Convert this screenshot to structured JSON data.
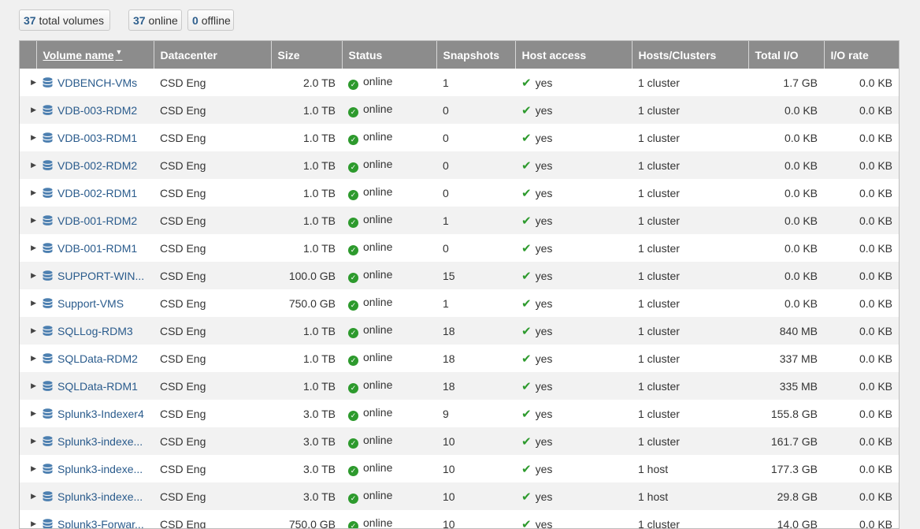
{
  "filters": {
    "total": {
      "count": "37",
      "label": "total volumes"
    },
    "online": {
      "count": "37",
      "label": "online"
    },
    "offline": {
      "count": "0",
      "label": "offline"
    }
  },
  "table": {
    "columns": {
      "name": "Volume name",
      "datacenter": "Datacenter",
      "size": "Size",
      "status": "Status",
      "snapshots": "Snapshots",
      "host_access": "Host access",
      "hosts_clusters": "Hosts/Clusters",
      "total_io": "Total I/O",
      "io_rate": "I/O rate"
    },
    "rows": [
      {
        "name": "VDBENCH-VMs",
        "datacenter": "CSD Eng",
        "size": "2.0 TB",
        "status": "online",
        "snapshots": "1",
        "host_access": "yes",
        "hosts_clusters": "1 cluster",
        "total_io": "1.7 GB",
        "io_rate": "0.0 KB"
      },
      {
        "name": "VDB-003-RDM2",
        "datacenter": "CSD Eng",
        "size": "1.0 TB",
        "status": "online",
        "snapshots": "0",
        "host_access": "yes",
        "hosts_clusters": "1 cluster",
        "total_io": "0.0 KB",
        "io_rate": "0.0 KB"
      },
      {
        "name": "VDB-003-RDM1",
        "datacenter": "CSD Eng",
        "size": "1.0 TB",
        "status": "online",
        "snapshots": "0",
        "host_access": "yes",
        "hosts_clusters": "1 cluster",
        "total_io": "0.0 KB",
        "io_rate": "0.0 KB"
      },
      {
        "name": "VDB-002-RDM2",
        "datacenter": "CSD Eng",
        "size": "1.0 TB",
        "status": "online",
        "snapshots": "0",
        "host_access": "yes",
        "hosts_clusters": "1 cluster",
        "total_io": "0.0 KB",
        "io_rate": "0.0 KB"
      },
      {
        "name": "VDB-002-RDM1",
        "datacenter": "CSD Eng",
        "size": "1.0 TB",
        "status": "online",
        "snapshots": "0",
        "host_access": "yes",
        "hosts_clusters": "1 cluster",
        "total_io": "0.0 KB",
        "io_rate": "0.0 KB"
      },
      {
        "name": "VDB-001-RDM2",
        "datacenter": "CSD Eng",
        "size": "1.0 TB",
        "status": "online",
        "snapshots": "1",
        "host_access": "yes",
        "hosts_clusters": "1 cluster",
        "total_io": "0.0 KB",
        "io_rate": "0.0 KB"
      },
      {
        "name": "VDB-001-RDM1",
        "datacenter": "CSD Eng",
        "size": "1.0 TB",
        "status": "online",
        "snapshots": "0",
        "host_access": "yes",
        "hosts_clusters": "1 cluster",
        "total_io": "0.0 KB",
        "io_rate": "0.0 KB"
      },
      {
        "name": "SUPPORT-WIN...",
        "datacenter": "CSD Eng",
        "size": "100.0 GB",
        "status": "online",
        "snapshots": "15",
        "host_access": "yes",
        "hosts_clusters": "1 cluster",
        "total_io": "0.0 KB",
        "io_rate": "0.0 KB"
      },
      {
        "name": "Support-VMS",
        "datacenter": "CSD Eng",
        "size": "750.0 GB",
        "status": "online",
        "snapshots": "1",
        "host_access": "yes",
        "hosts_clusters": "1 cluster",
        "total_io": "0.0 KB",
        "io_rate": "0.0 KB"
      },
      {
        "name": "SQLLog-RDM3",
        "datacenter": "CSD Eng",
        "size": "1.0 TB",
        "status": "online",
        "snapshots": "18",
        "host_access": "yes",
        "hosts_clusters": "1 cluster",
        "total_io": "840 MB",
        "io_rate": "0.0 KB"
      },
      {
        "name": "SQLData-RDM2",
        "datacenter": "CSD Eng",
        "size": "1.0 TB",
        "status": "online",
        "snapshots": "18",
        "host_access": "yes",
        "hosts_clusters": "1 cluster",
        "total_io": "337 MB",
        "io_rate": "0.0 KB"
      },
      {
        "name": "SQLData-RDM1",
        "datacenter": "CSD Eng",
        "size": "1.0 TB",
        "status": "online",
        "snapshots": "18",
        "host_access": "yes",
        "hosts_clusters": "1 cluster",
        "total_io": "335 MB",
        "io_rate": "0.0 KB"
      },
      {
        "name": "Splunk3-Indexer4",
        "datacenter": "CSD Eng",
        "size": "3.0 TB",
        "status": "online",
        "snapshots": "9",
        "host_access": "yes",
        "hosts_clusters": "1 cluster",
        "total_io": "155.8 GB",
        "io_rate": "0.0 KB"
      },
      {
        "name": "Splunk3-indexe...",
        "datacenter": "CSD Eng",
        "size": "3.0 TB",
        "status": "online",
        "snapshots": "10",
        "host_access": "yes",
        "hosts_clusters": "1 cluster",
        "total_io": "161.7 GB",
        "io_rate": "0.0 KB"
      },
      {
        "name": "Splunk3-indexe...",
        "datacenter": "CSD Eng",
        "size": "3.0 TB",
        "status": "online",
        "snapshots": "10",
        "host_access": "yes",
        "hosts_clusters": "1 host",
        "total_io": "177.3 GB",
        "io_rate": "0.0 KB"
      },
      {
        "name": "Splunk3-indexe...",
        "datacenter": "CSD Eng",
        "size": "3.0 TB",
        "status": "online",
        "snapshots": "10",
        "host_access": "yes",
        "hosts_clusters": "1 host",
        "total_io": "29.8 GB",
        "io_rate": "0.0 KB"
      },
      {
        "name": "Splunk3-Forwar...",
        "datacenter": "CSD Eng",
        "size": "750.0 GB",
        "status": "online",
        "snapshots": "10",
        "host_access": "yes",
        "hosts_clusters": "1 cluster",
        "total_io": "14.0 GB",
        "io_rate": "0.0 KB"
      }
    ]
  },
  "colors": {
    "header_bg": "#8c8c8c",
    "link": "#2a5b8c",
    "status_green": "#2d9a2d"
  },
  "icons": {
    "row_expand": "caret-right-icon",
    "volume": "database-icon",
    "status": "check-circle-icon",
    "host_access": "checkmark-icon",
    "sort": "sort-desc-icon"
  }
}
